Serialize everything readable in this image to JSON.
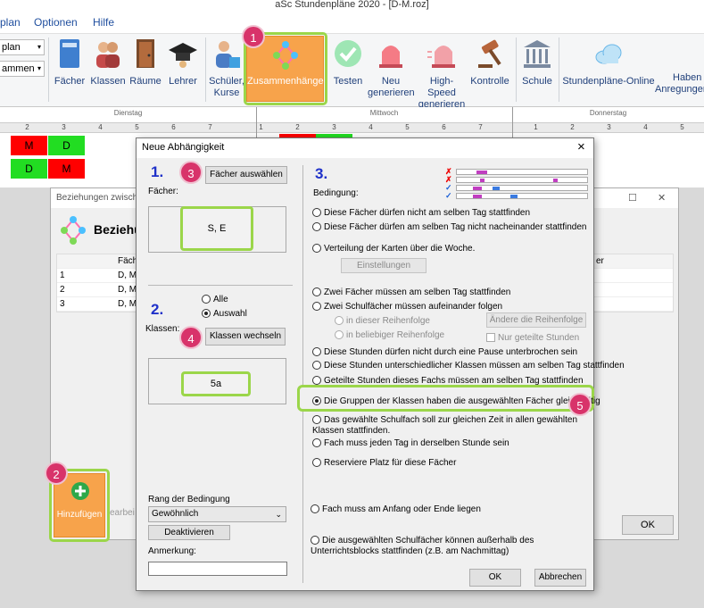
{
  "app": {
    "title": "aSc Stundenpläne 2020 - [D-M.roz]"
  },
  "menu": {
    "items": [
      "plan",
      "Optionen",
      "Hilfe"
    ]
  },
  "left_dropdowns": [
    "plan",
    "ammen"
  ],
  "ribbon": {
    "buttons": [
      "Fächer",
      "Klassen",
      "Räume",
      "Lehrer"
    ],
    "schueler_line1": "Schüler,",
    "schueler_line2": "Kurse",
    "zusammen": "Zusammenhänge",
    "testen": "Testen",
    "neu_line1": "Neu",
    "neu_line2": "generieren",
    "hs_line1": "High-Speed",
    "hs_line2": "generieren",
    "kontrolle": "Kontrolle",
    "schule": "Schule",
    "online": "Stundenpläne-Online",
    "haben_line1": "Haben",
    "haben_line2": "Anregunger"
  },
  "timetable": {
    "days": [
      "Dienstag",
      "Mittwoch",
      "Donnerstag"
    ],
    "periods": [
      "2",
      "3",
      "4",
      "5",
      "6",
      "7",
      "1",
      "2",
      "3",
      "4",
      "5",
      "6",
      "7",
      "1",
      "2",
      "3",
      "4",
      "5"
    ],
    "row1": [
      "M",
      "D"
    ],
    "row2": [
      "D",
      "M"
    ]
  },
  "bg_window": {
    "title": "Beziehungen zwische",
    "header": "Beziehu",
    "col_faecher": "Fäche",
    "col_right": "er",
    "rows": [
      {
        "num": "1",
        "val": "D, M"
      },
      {
        "num": "2",
        "val": "D, M"
      },
      {
        "num": "3",
        "val": "D, M"
      }
    ],
    "add_button": "Hinzufügen",
    "edit_label": "earbei",
    "ok": "OK"
  },
  "dialog": {
    "title": "Neue Abhängigkeit",
    "close": "×",
    "step1": "1.",
    "step2": "2.",
    "step3": "3.",
    "faecher_btn": "Fächer auswählen",
    "faecher_label": "Fächer:",
    "faecher_value": "S, E",
    "radio_alle": "Alle",
    "radio_auswahl": "Auswahl",
    "klassen_btn": "Klassen wechseln",
    "klassen_label": "Klassen:",
    "klassen_value": "5a",
    "rang_label": "Rang der Bedingung",
    "rang_value": "Gewöhnlich",
    "deaktivieren": "Deaktivieren",
    "anmerkung_label": "Anmerkung:",
    "bedingung_label": "Bedingung:",
    "options": [
      "Diese Fächer dürfen nicht am selben Tag stattfinden",
      "Diese Fächer dürfen am selben Tag nicht nacheinander stattfinden",
      "Verteilung der Karten über die Woche.",
      "Zwei Fächer müssen am selben Tag stattfinden",
      "Zwei Schulfächer müssen aufeinander folgen",
      "Diese Stunden dürfen nicht durch eine Pause unterbrochen sein",
      "Diese Stunden unterschiedlicher Klassen müssen am selben Tag stattfinden",
      "Geteilte Stunden dieses Fachs müssen am selben Tag stattfinden",
      "Die Gruppen der Klassen haben die ausgewählten Fächer gleichzeitig",
      "Das gewählte Schulfach soll zur gleichen Zeit in allen gewählten Klassen stattfinden.",
      "Fach muss jeden Tag in derselben Stunde sein",
      "Reserviere Platz für diese Fächer",
      "Fach muss am Anfang oder Ende liegen",
      "Die ausgewählten Schulfächer können außerhalb des Unterrichtsblocks stattfinden (z.B. am Nachmittag)"
    ],
    "einstellungen": "Einstellungen",
    "sub_order": "in dieser Reihenfolge",
    "sub_any": "in beliebiger Reihenfolge",
    "aendere": "Ändere die Reihenfolge",
    "nur_geteilte": "Nur geteilte Stunden",
    "ok": "OK",
    "abbrechen": "Abbrechen"
  },
  "badges": [
    "1",
    "2",
    "3",
    "4",
    "5"
  ],
  "colors": {
    "red": "#ff0000",
    "green": "#22dd22",
    "orange": "#f7a34b",
    "highlight": "#9bd64a",
    "badge": "#d8336a",
    "step": "#1f31c9"
  }
}
